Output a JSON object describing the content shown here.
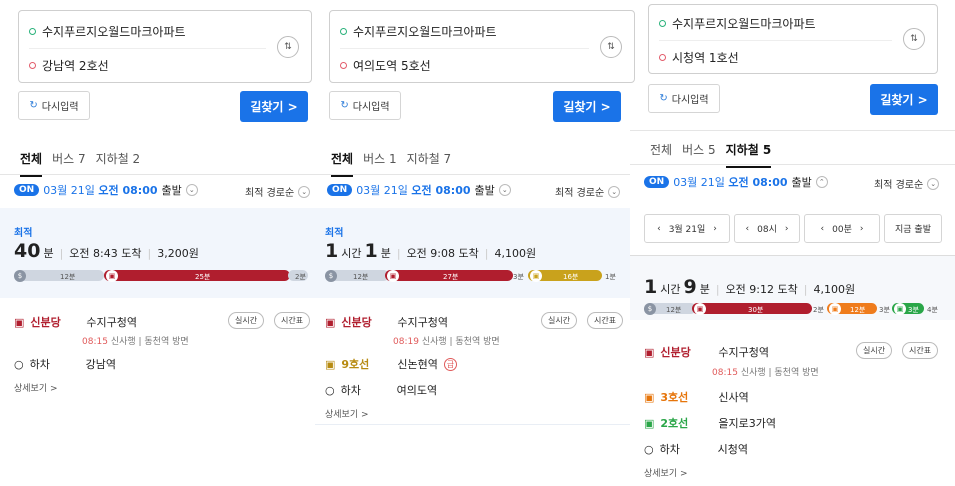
{
  "panels": [
    {
      "origin": "수지푸르지오월드마크아파트",
      "destination": "강남역 2호선",
      "reset_label": "다시입력",
      "search_label": "길찾기 >",
      "tabs": [
        "전체",
        "버스 7",
        "지하철 2"
      ],
      "date_prefix": "03월 21일 ",
      "date_time": "오전 08:00",
      "date_suffix": " 출발",
      "on_label": "ON",
      "sort_label": "최적 경로순",
      "best_label": "최적",
      "duration_main": "40",
      "duration_unit": "분",
      "arrival": "오전 8:43 도착",
      "fare": "3,200원",
      "segments": [
        {
          "label": "12분"
        },
        {
          "label": "25분"
        },
        {
          "label": "2분"
        }
      ],
      "steps": [
        {
          "line": "신분당",
          "station": "수지구청역"
        },
        {
          "line": "하차",
          "station": "강남역"
        }
      ],
      "sub_time": "08:15",
      "sub_info": "신사행 | 동천역 방면",
      "realtime": "실시간",
      "timetable": "시간표",
      "detail": "상세보기 >"
    },
    {
      "origin": "수지푸르지오월드마크아파트",
      "destination": "여의도역 5호선",
      "reset_label": "다시입력",
      "search_label": "길찾기 >",
      "tabs": [
        "전체",
        "버스 1",
        "지하철 7"
      ],
      "date_prefix": "03월 21일 ",
      "date_time": "오전 08:00",
      "date_suffix": " 출발",
      "on_label": "ON",
      "sort_label": "최적 경로순",
      "best_label": "최적",
      "duration_h": "1",
      "duration_h_unit": "시간",
      "duration_m": "1",
      "duration_m_unit": "분",
      "arrival": "오전 9:08 도착",
      "fare": "4,100원",
      "segments": [
        {
          "label": "12분"
        },
        {
          "label": "27분"
        },
        {
          "label": "3분"
        },
        {
          "label": "16분"
        },
        {
          "label": "1분"
        }
      ],
      "steps": [
        {
          "line": "신분당",
          "station": "수지구청역"
        },
        {
          "line": "9호선",
          "station": "신논현역"
        },
        {
          "line": "하차",
          "station": "여의도역"
        }
      ],
      "transfer_mark": "급",
      "sub_time": "08:19",
      "sub_info": "신사행 | 동천역 방면",
      "realtime": "실시간",
      "timetable": "시간표",
      "detail": "상세보기 >"
    },
    {
      "origin": "수지푸르지오월드마크아파트",
      "destination": "시청역 1호선",
      "reset_label": "다시입력",
      "search_label": "길찾기 >",
      "tabs": [
        "전체",
        "버스 5",
        "지하철 5"
      ],
      "date_prefix": "03월 21일 ",
      "date_time": "오전 08:00",
      "date_suffix": " 출발",
      "on_label": "ON",
      "sort_label": "최적 경로순",
      "selector": {
        "date": "3월 21일",
        "hour": "08시",
        "minute": "00분",
        "now": "지금 출발"
      },
      "duration_h": "1",
      "duration_h_unit": "시간",
      "duration_m": "9",
      "duration_m_unit": "분",
      "arrival": "오전 9:12 도착",
      "fare": "4,100원",
      "segments": [
        {
          "label": "12분"
        },
        {
          "label": "30분"
        },
        {
          "label": "2분"
        },
        {
          "label": "12분"
        },
        {
          "label": "3분"
        },
        {
          "label": "3분"
        },
        {
          "label": "4분"
        }
      ],
      "steps": [
        {
          "line": "신분당",
          "station": "수지구청역"
        },
        {
          "line": "3호선",
          "station": "신사역"
        },
        {
          "line": "2호선",
          "station": "을지로3가역"
        },
        {
          "line": "하차",
          "station": "시청역"
        }
      ],
      "sub_time": "08:15",
      "sub_info": "신사행 | 동천역 방면",
      "realtime": "실시간",
      "timetable": "시간표",
      "detail": "상세보기 >"
    }
  ],
  "colors": {
    "accent": "#1a73e8",
    "shinbundang": "#b01e2e",
    "line9": "#c9a21c",
    "line3": "#ef7c1c",
    "line2": "#2aa648",
    "walk": "#cfd6e0"
  }
}
